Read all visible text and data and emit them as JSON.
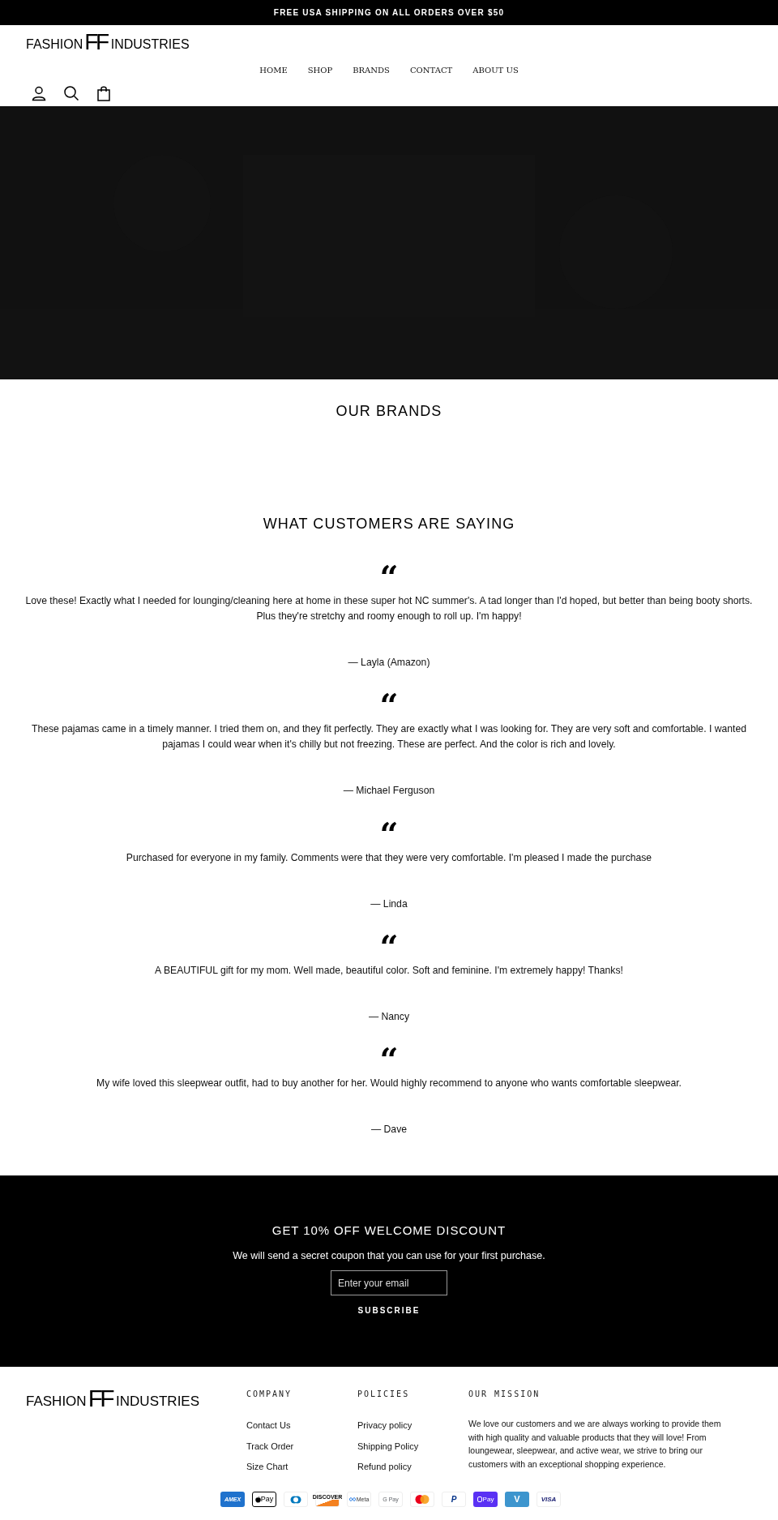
{
  "announcement": "FREE USA SHIPPING ON ALL ORDERS OVER $50",
  "logo": {
    "left": "FASHION",
    "mark": "FF",
    "right": "INDUSTRIES"
  },
  "nav": [
    "HOME",
    "SHOP",
    "BRANDS",
    "CONTACT",
    "ABOUT US"
  ],
  "brands": {
    "title": "OUR BRANDS"
  },
  "testimonials": {
    "title": "WHAT CUSTOMERS ARE SAYING",
    "items": [
      {
        "mark": "“",
        "text": "Love these! Exactly what I needed for lounging/cleaning here at home in these super hot NC summer's. A tad longer than I'd hoped, but better than being booty shorts. Plus they're stretchy and roomy enough to roll up. I'm happy!",
        "author": "— Layla (Amazon)"
      },
      {
        "mark": "“",
        "text": "These pajamas came in a timely manner. I tried them on, and they fit perfectly. They are exactly what I was looking for. They are very soft and comfortable. I wanted pajamas I could wear when it's chilly but not freezing. These are perfect. And the color is rich and lovely.",
        "author": "— Michael Ferguson"
      },
      {
        "mark": "“",
        "text": "Purchased for everyone in my family. Comments were that they were very comfortable. I'm pleased I made the purchase",
        "author": "— Linda"
      },
      {
        "mark": "“",
        "text": "A BEAUTIFUL gift for my mom. Well made, beautiful color. Soft and feminine. I'm extremely happy! Thanks!",
        "author": "— Nancy"
      },
      {
        "mark": "“",
        "text": "My wife loved this sleepwear outfit, had to buy another for her. Would highly recommend to anyone who wants comfortable sleepwear.",
        "author": "— Dave"
      }
    ]
  },
  "newsletter": {
    "title": "GET 10% OFF WELCOME DISCOUNT",
    "text": "We will send a secret coupon that you can use for your first purchase.",
    "placeholder": "Enter your email",
    "button": "SUBSCRIBE"
  },
  "footer": {
    "logo": {
      "left": "FASHION",
      "mark": "FF",
      "right": "INDUSTRIES"
    },
    "columns": [
      {
        "title": "COMPANY",
        "links": [
          "Contact Us",
          "Track Order",
          "Size Chart"
        ]
      },
      {
        "title": "POLICIES",
        "links": [
          "Privacy policy",
          "Shipping Policy",
          "Refund policy"
        ]
      }
    ],
    "mission": {
      "title": "OUR MISSION",
      "text": "We love our customers and we are always working to provide them with high quality and valuable products that they will love! From loungewear, sleepwear, and active wear, we strive to bring our customers with an exceptional shopping experience."
    },
    "payments": [
      {
        "kind": "amex",
        "label": "AMEX"
      },
      {
        "kind": "applepay",
        "label": "Pay"
      },
      {
        "kind": "diners"
      },
      {
        "kind": "discover",
        "label": "DISCOVER"
      },
      {
        "kind": "meta",
        "label": "Meta"
      },
      {
        "kind": "googlepay",
        "label": "G Pay"
      },
      {
        "kind": "mastercard"
      },
      {
        "kind": "paypal",
        "label": "P"
      },
      {
        "kind": "shoppay",
        "label": "Pay"
      },
      {
        "kind": "venmo",
        "label": "V"
      },
      {
        "kind": "visa",
        "label": "VISA"
      }
    ]
  }
}
